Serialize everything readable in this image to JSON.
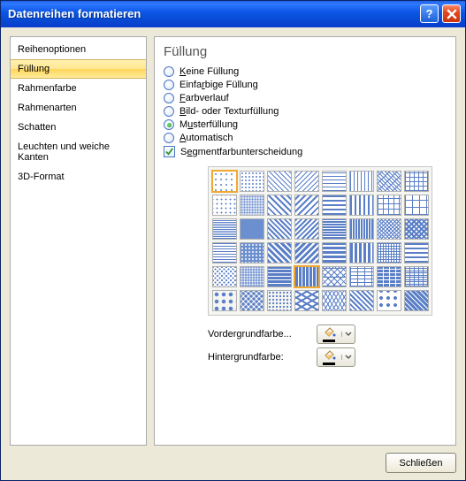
{
  "window": {
    "title": "Datenreihen formatieren"
  },
  "sidebar": {
    "items": [
      {
        "label": "Reihenoptionen"
      },
      {
        "label": "Füllung",
        "selected": true
      },
      {
        "label": "Rahmenfarbe"
      },
      {
        "label": "Rahmenarten"
      },
      {
        "label": "Schatten"
      },
      {
        "label": "Leuchten und weiche Kanten"
      },
      {
        "label": "3D-Format"
      }
    ]
  },
  "main": {
    "heading": "Füllung",
    "options": {
      "none": {
        "label_pre": "",
        "ul": "K",
        "label_post": "eine Füllung",
        "checked": false
      },
      "solid": {
        "label_pre": "Einfa",
        "ul": "r",
        "label_post": "bige Füllung",
        "checked": false
      },
      "gradient": {
        "label_pre": "",
        "ul": "F",
        "label_post": "arbverlauf",
        "checked": false
      },
      "picture": {
        "label_pre": "",
        "ul": "B",
        "label_post": "ild- oder Texturfüllung",
        "checked": false
      },
      "pattern": {
        "label_pre": "M",
        "ul": "u",
        "label_post": "sterfüllung",
        "checked": true
      },
      "automatic": {
        "label_pre": "",
        "ul": "A",
        "label_post": "utomatisch",
        "checked": false
      }
    },
    "segment_vary": {
      "label_pre": "S",
      "ul": "e",
      "label_post": "gmentfarbunterscheidung",
      "checked": true
    },
    "foreground": {
      "label_pre": "",
      "ul": "V",
      "label_post": "ordergrundfarbe..."
    },
    "background": {
      "label_pre": "H",
      "ul": "i",
      "label_post": "ntergrundfarbe:"
    },
    "selected_pattern_index": 0,
    "second_selected_pattern_index": 35
  },
  "footer": {
    "close": "Schließen"
  }
}
